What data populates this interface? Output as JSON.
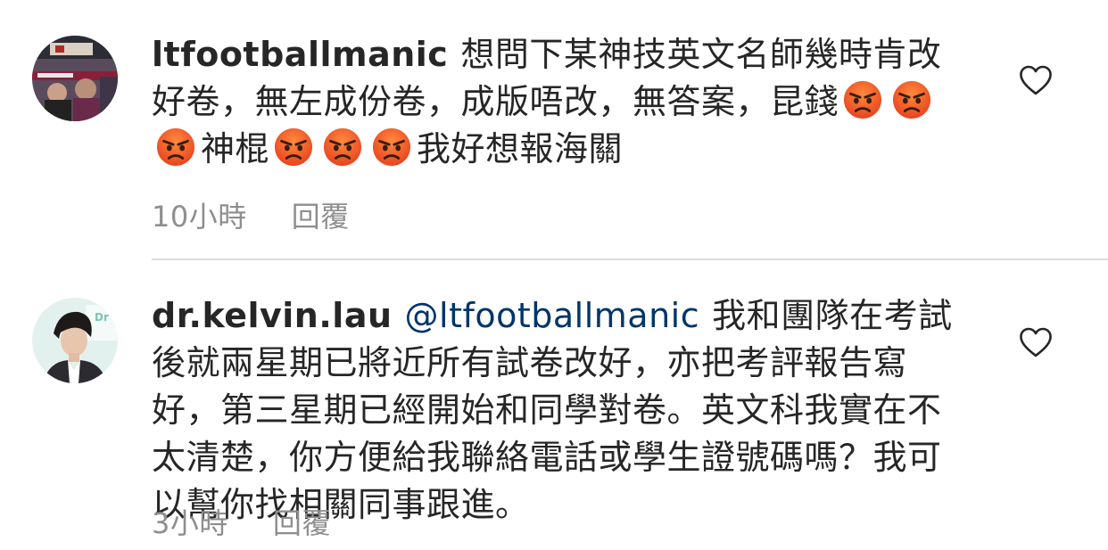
{
  "comments": [
    {
      "username": "ltfootballmanic",
      "segments": [
        "想問下某神技英文名師幾時肯改好卷，無左成份卷，成版唔改，無答案，昆錢",
        "神棍",
        "我好想報海關"
      ],
      "emoji_icon": "angry-face-emoji",
      "time": "10小時",
      "reply_label": "回覆"
    },
    {
      "username": "dr.kelvin.lau",
      "mention": "@ltfootballmanic",
      "text": "我和團隊在考試後就兩星期已將近所有試卷改好，亦把考評報告寫好，第三星期已經開始和同學對卷。英文科我實在不太清楚，你方便給我聯絡電話或學生證號碼嗎？我可以幫你找相關同事跟進。",
      "time": "3小時",
      "reply_label": "回覆"
    }
  ],
  "colors": {
    "text": "#262626",
    "secondary": "#8e8e8e",
    "mention": "#003569",
    "divider": "#dbdbdb"
  }
}
